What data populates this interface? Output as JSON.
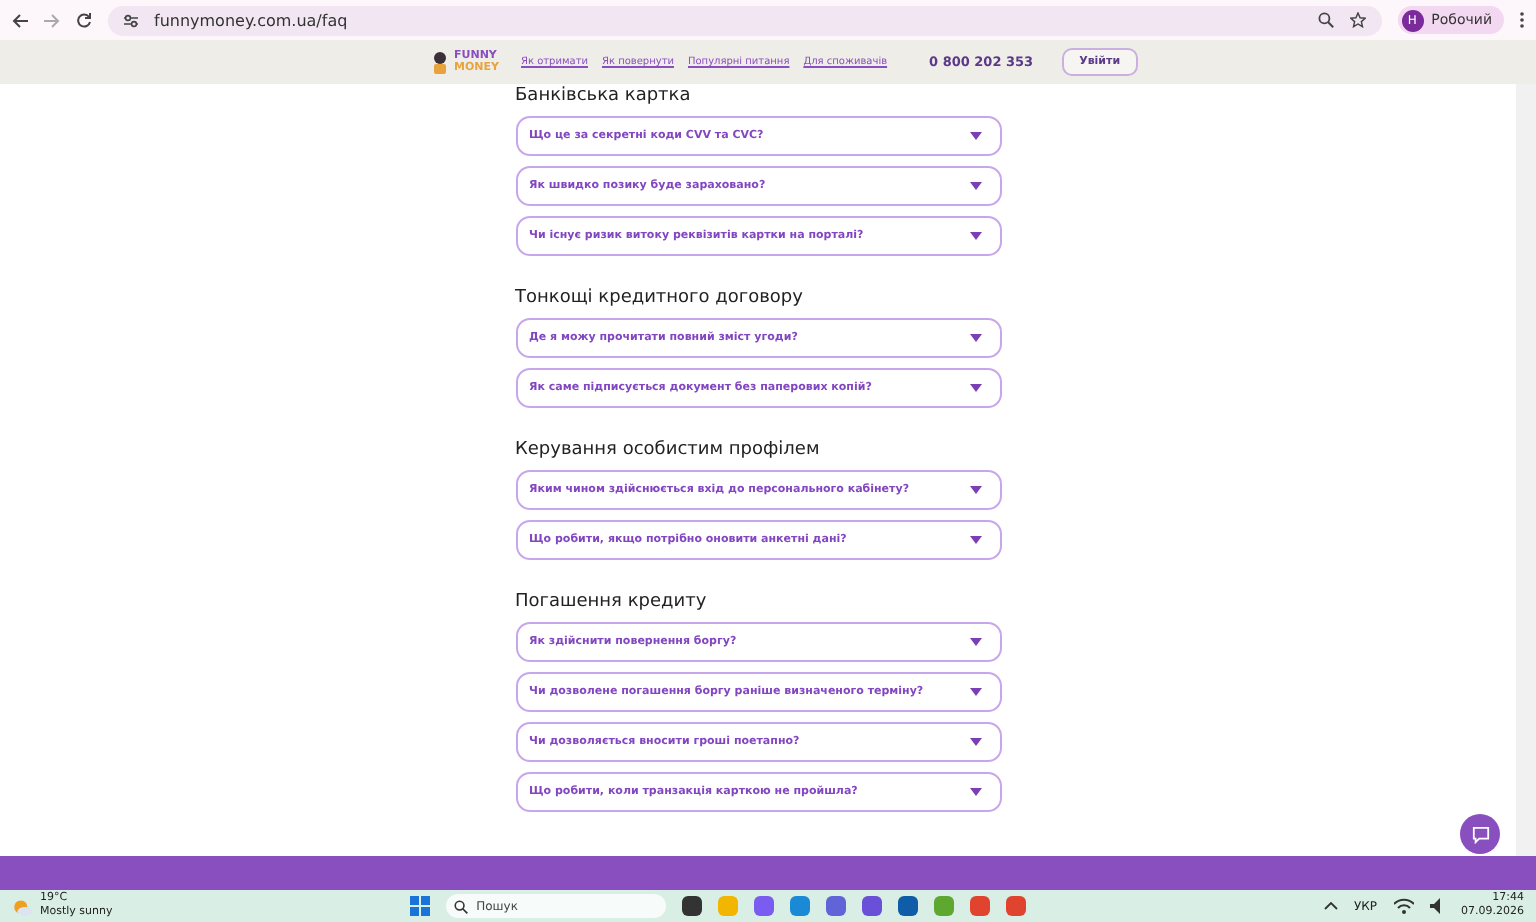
{
  "browser": {
    "url": "funnymoney.com.ua/faq",
    "profile_initial": "Н",
    "profile_name": "Робочий"
  },
  "site_header": {
    "logo_top": "FUNNY",
    "logo_bottom": "MONEY",
    "nav": [
      "Як отримати",
      "Як повернути",
      "Популярні питання",
      "Для споживачів"
    ],
    "phone": "0 800 202 353",
    "login_button": "Увійти"
  },
  "sections": [
    {
      "title": "Банківська картка",
      "questions": [
        {
          "text": "Що це за секретні коди CVV та CVC?",
          "expanded": false
        },
        {
          "text": "Як швидко позику буде зараховано?",
          "expanded": false
        },
        {
          "text": "Чи існує ризик витоку реквізитів картки на порталі?",
          "expanded": false
        }
      ]
    },
    {
      "title": "Тонкощі кредитного договору",
      "questions": [
        {
          "text": "Де я можу прочитати повний зміст угоди?",
          "expanded": false
        },
        {
          "text": "Як саме підписується документ без паперових копій?",
          "expanded": false
        }
      ]
    },
    {
      "title": "Керування особистим профілем",
      "questions": [
        {
          "text": "Яким чином здійснюється вхід до персонального кабінету?",
          "expanded": false
        },
        {
          "text": "Що робити, якщо потрібно оновити анкетні дані?",
          "expanded": false
        }
      ]
    },
    {
      "title": "Погашення кредиту",
      "questions": [
        {
          "text": "Як здійснити повернення боргу?",
          "expanded": false
        },
        {
          "text": "Чи дозволене погашення боргу раніше визначеного терміну?",
          "expanded": false
        },
        {
          "text": "Чи дозволяється вносити гроші поетапно?",
          "expanded": false
        },
        {
          "text": "Що робити, коли транзакція карткою не пройшла?",
          "expanded": false
        }
      ]
    }
  ],
  "taskbar": {
    "temperature": "19°C",
    "weather": "Mostly sunny",
    "search_placeholder": "Пошук",
    "language": "УКР",
    "time": "17:44",
    "date": "07.09.2026"
  }
}
